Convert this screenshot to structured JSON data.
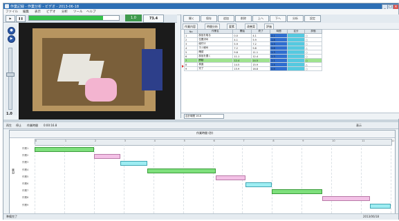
{
  "window": {
    "title": "作業記録 - 作業分析 - ビデオ - 2013-06-18",
    "buttons": [
      "_",
      "□",
      "×"
    ]
  },
  "menu": [
    "ファイル",
    "編集",
    "表示",
    "ビデオ",
    "分析",
    "ツール",
    "ヘルプ"
  ],
  "toolbar": {
    "progress_fraction": 0.82,
    "counter_value": "73.4",
    "speed_value": "1.0"
  },
  "video_panel": {
    "zoom_label": "1.0",
    "slider_fraction": 0.45
  },
  "right_toolbar": {
    "buttons": [
      "開く",
      "保存",
      "追加",
      "削除",
      "上へ",
      "下へ",
      "分析",
      "設定"
    ]
  },
  "right_tabs": [
    "作業内容",
    "時間分析",
    "要素",
    "改善案",
    "評価"
  ],
  "task_table": {
    "headers": [
      "No",
      "作業名",
      "開始",
      "終了",
      "時間",
      "区分",
      "評価"
    ],
    "rows": [
      [
        "1",
        "部品を取る",
        "0.0",
        "4.1",
        "4.1",
        "",
        "○"
      ],
      [
        "2",
        "位置決め",
        "4.1",
        "5.9",
        "1.8",
        "",
        "○"
      ],
      [
        "3",
        "組付け",
        "5.9",
        "7.2",
        "1.3",
        "",
        "○"
      ],
      [
        "4",
        "ネジ締め",
        "7.2",
        "9.8",
        "2.6",
        "",
        "△"
      ],
      [
        "5",
        "確認",
        "9.8",
        "11.1",
        "1.3",
        "",
        "○"
      ],
      [
        "6",
        "部品を置く",
        "11.1",
        "12.4",
        "1.3",
        "",
        "○"
      ],
      [
        "7",
        "移動",
        "12.4",
        "14.5",
        "2.1",
        "",
        "○"
      ],
      [
        "8",
        "検査",
        "14.5",
        "15.9",
        "1.4",
        "",
        "△"
      ],
      [
        "9",
        "完了",
        "15.9",
        "16.8",
        "0.9",
        "",
        "○"
      ]
    ],
    "selected_row": 6
  },
  "right_footer": {
    "value": "合計時間 16.8"
  },
  "timeline_bar": {
    "labels": [
      "再生",
      "停止",
      "作業時間",
      "0:00:16.8",
      "表示"
    ]
  },
  "gantt": {
    "title": "作業時間 (秒)",
    "y_label": "作業",
    "ticks": [
      "0",
      "1",
      "2",
      "3",
      "4",
      "5",
      "6",
      "7",
      "8",
      "9",
      "10",
      "11",
      "12"
    ],
    "rows": [
      "作業1",
      "作業2",
      "作業3",
      "作業4",
      "作業5",
      "作業6",
      "作業7",
      "作業8",
      "作業9"
    ]
  },
  "status": {
    "left": "準備完了",
    "right": "2013/06/18"
  },
  "chart_data": {
    "type": "bar",
    "title": "作業時間 (秒)",
    "xlabel": "",
    "ylabel": "作業",
    "xlim": [
      0,
      12
    ],
    "bars": [
      {
        "row": 0,
        "start": 0.0,
        "end": 2.0,
        "color": "green"
      },
      {
        "row": 1,
        "start": 2.0,
        "end": 2.9,
        "color": "pink"
      },
      {
        "row": 2,
        "start": 2.9,
        "end": 3.8,
        "color": "cyan"
      },
      {
        "row": 3,
        "start": 3.8,
        "end": 6.1,
        "color": "green"
      },
      {
        "row": 4,
        "start": 6.1,
        "end": 7.1,
        "color": "pink"
      },
      {
        "row": 5,
        "start": 7.1,
        "end": 8.0,
        "color": "cyan"
      },
      {
        "row": 6,
        "start": 8.0,
        "end": 9.7,
        "color": "green"
      },
      {
        "row": 7,
        "start": 9.7,
        "end": 11.3,
        "color": "pink"
      },
      {
        "row": 8,
        "start": 11.3,
        "end": 12.0,
        "color": "cyan"
      }
    ]
  }
}
